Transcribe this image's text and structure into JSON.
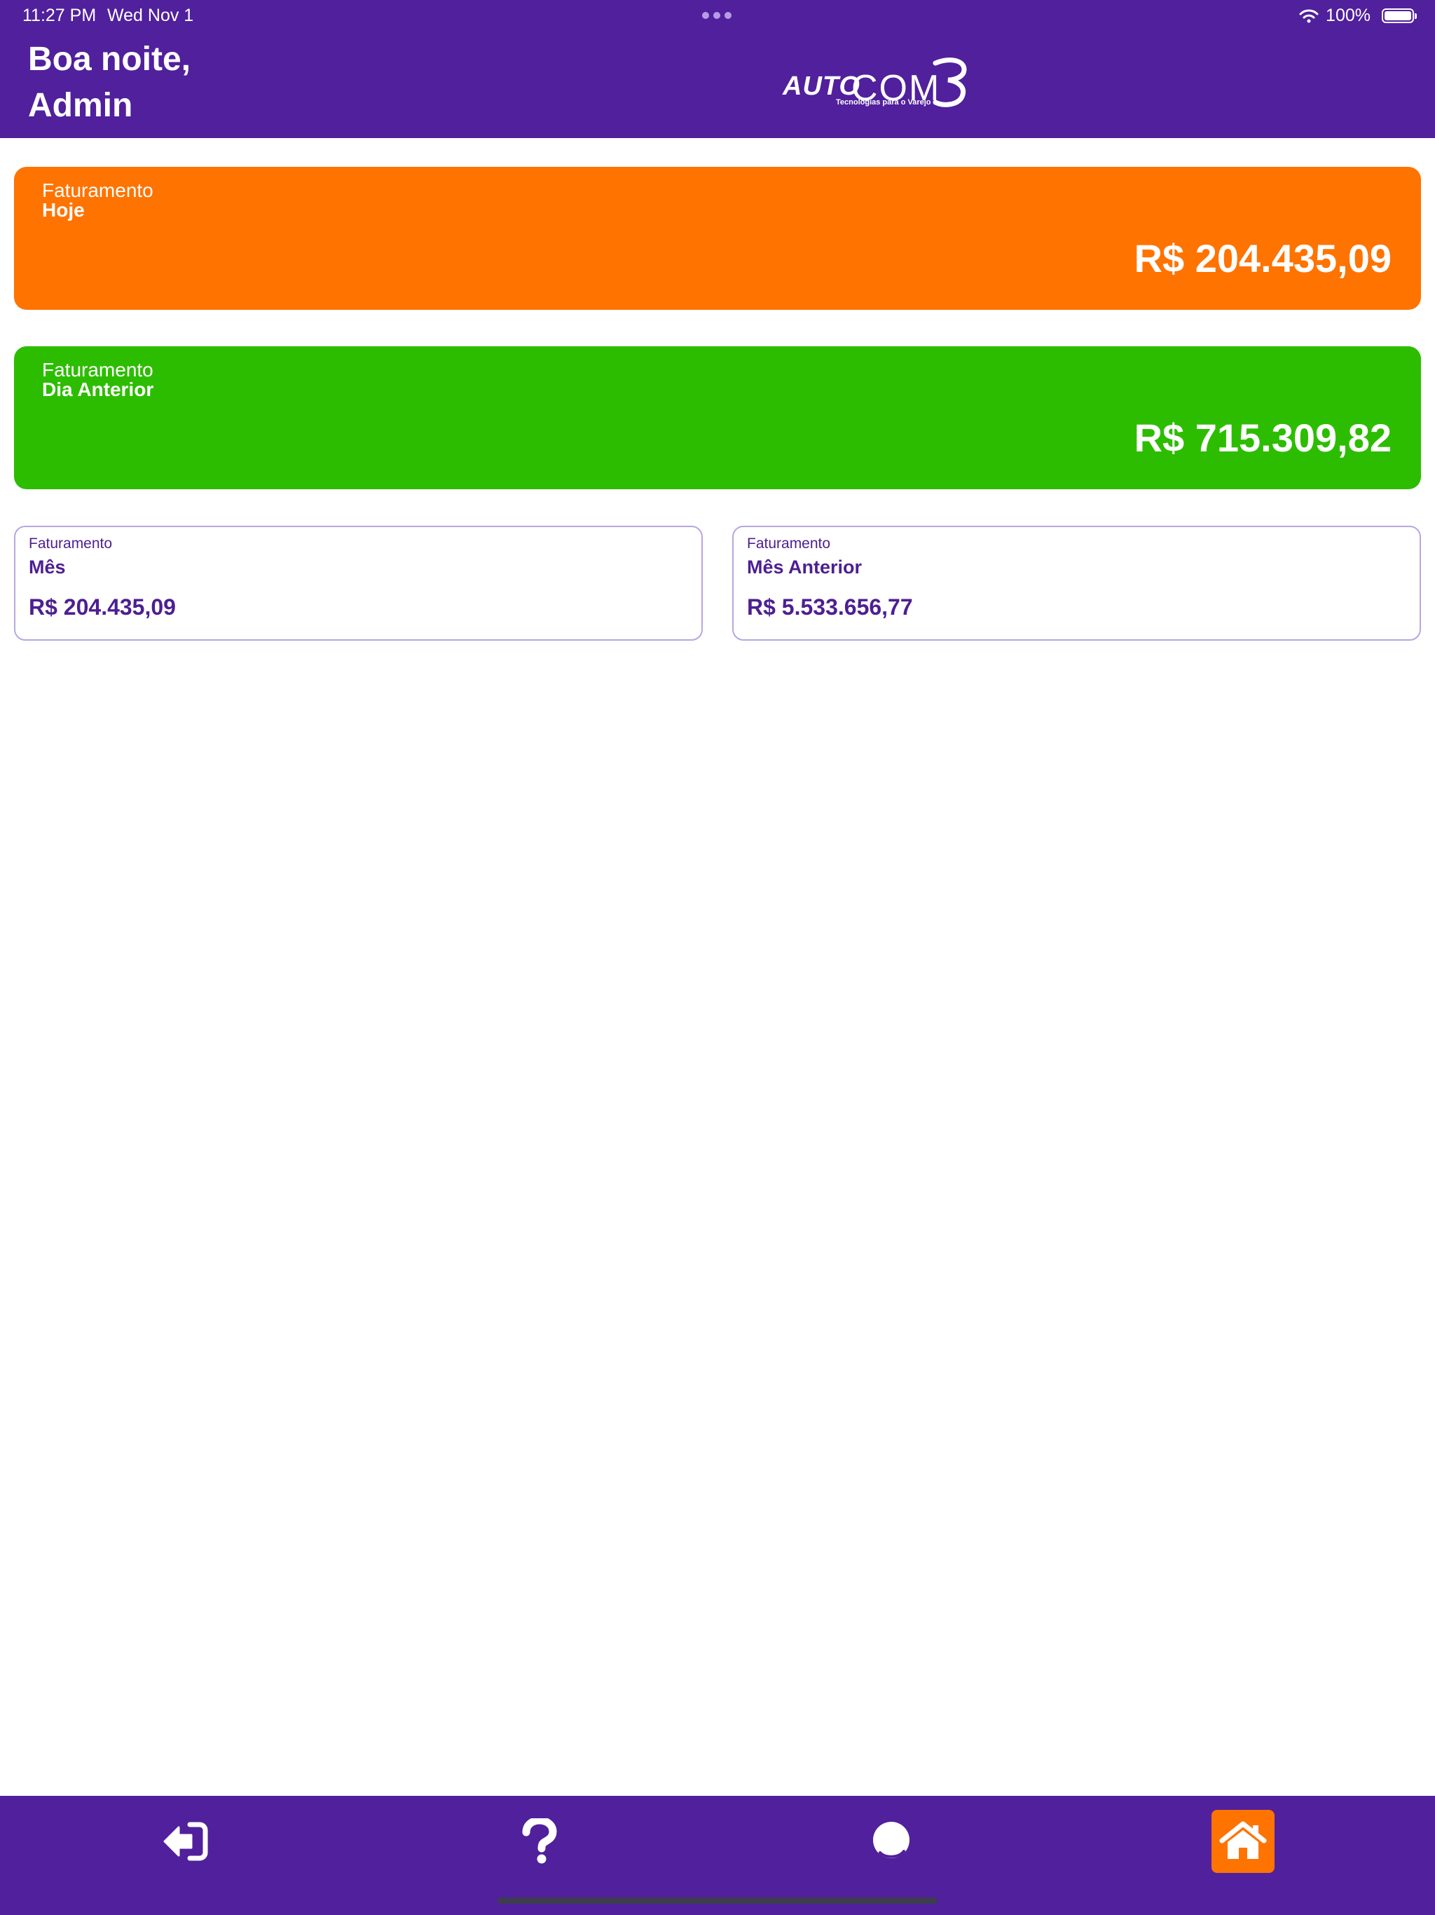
{
  "status_bar": {
    "time": "11:27 PM",
    "date": "Wed Nov 1",
    "battery": "100%"
  },
  "header": {
    "greeting_line1": "Boa noite,",
    "greeting_line2": "Admin",
    "logo": {
      "auto": "AUTO",
      "com": "COM",
      "tagline": "Tecnologias para o Varejo"
    }
  },
  "cards": {
    "today": {
      "label": "Faturamento",
      "period": "Hoje",
      "value": "R$ 204.435,09",
      "color": "#ff7300"
    },
    "yesterday": {
      "label": "Faturamento",
      "period": "Dia Anterior",
      "value": "R$ 715.309,82",
      "color": "#2dbd00"
    },
    "month": {
      "label": "Faturamento",
      "period": "Mês",
      "value": "R$ 204.435,09"
    },
    "previous_month": {
      "label": "Faturamento",
      "period": "Mês Anterior",
      "value": "R$ 5.533.656,77"
    }
  },
  "bottom_nav": {
    "items": [
      {
        "icon": "logout-icon"
      },
      {
        "icon": "help-icon"
      },
      {
        "icon": "chat-icon"
      },
      {
        "icon": "home-icon",
        "active": true
      }
    ]
  },
  "colors": {
    "brand_purple": "#51209c",
    "accent_orange": "#ff7300",
    "success_green": "#2dbd00",
    "card_text_purple": "#4d1f91"
  }
}
